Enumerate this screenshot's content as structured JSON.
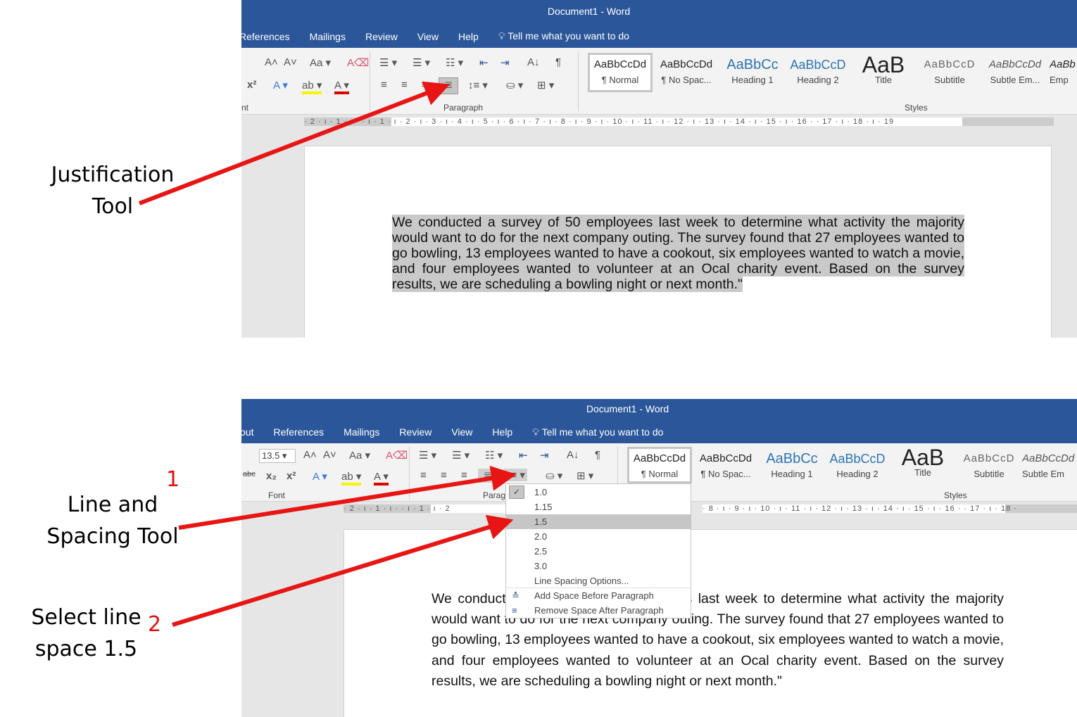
{
  "annotations": {
    "justification": [
      "Justification",
      "Tool"
    ],
    "line_spacing": [
      "Line and",
      "Spacing Tool"
    ],
    "select": [
      "Select line",
      "space 1.5"
    ],
    "step1": "1",
    "step2": "2",
    "arrow_color": "#e81515"
  },
  "top": {
    "title": "Document1  -  Word",
    "tabs": [
      "References",
      "Mailings",
      "Review",
      "View",
      "Help"
    ],
    "tell_me": "Tell me what you want to do",
    "groups": {
      "font": "nt",
      "paragraph": "Paragraph",
      "styles": "Styles"
    },
    "styles": [
      {
        "preview": "AaBbCcDd",
        "name": "¶ Normal"
      },
      {
        "preview": "AaBbCcDd",
        "name": "¶ No Spac..."
      },
      {
        "preview": "AaBbCc",
        "name": "Heading 1"
      },
      {
        "preview": "AaBbCcD",
        "name": "Heading 2"
      },
      {
        "preview": "AaB",
        "name": "Title"
      },
      {
        "preview": "AaBbCcD",
        "name": "Subtitle"
      },
      {
        "preview": "AaBbCcDd",
        "name": "Subtle Em..."
      },
      {
        "preview": "AaBb",
        "name": "Emp"
      }
    ],
    "ruler": "· 2 · ı · 1 · ı ·   · ı · 1 · ı · 2 · ı · 3 · ı · 4 · ı · 5 · ı · 6 · ı · 7 · ı · 8 · ı · 9 · ı · 10 · ı · 11 · ı · 12 · ı · 13 · ı · 14 · ı · 15 · ı · 16 ·   · 17 · ı · 18 · ı · 19",
    "paragraph": "We conducted a survey of 50 employees last week to determine what activity the majority would want to do for the next company outing. The survey found that 27 employees wanted to go bowling, 13 employees wanted to have a cookout, six employees wanted to watch a movie, and four employees wanted to volunteer at an Ocal charity event. Based on the survey results, we are scheduling a bowling night or next month.\""
  },
  "bottom": {
    "title": "Document1  -  Word",
    "tabs": [
      "out",
      "References",
      "Mailings",
      "Review",
      "View",
      "Help"
    ],
    "tell_me": "Tell me what you want to do",
    "font_size": "13.5",
    "groups": {
      "font": "Font",
      "paragraph": "Parag",
      "styles": "Styles"
    },
    "styles": [
      {
        "preview": "AaBbCcDd",
        "name": "¶ Normal"
      },
      {
        "preview": "AaBbCcDd",
        "name": "¶ No Spac..."
      },
      {
        "preview": "AaBbCc",
        "name": "Heading 1"
      },
      {
        "preview": "AaBbCcD",
        "name": "Heading 2"
      },
      {
        "preview": "AaB",
        "name": "Title"
      },
      {
        "preview": "AaBbCcD",
        "name": "Subtitle"
      },
      {
        "preview": "AaBbCcDd",
        "name": "Subtle Em"
      }
    ],
    "ruler": "· 2 · ı · 1 · ı ·   · ı · 1 · ı · 2",
    "ruler_right": "· 8 · ı · 9 · ı · 10 · ı · 11 · ı · 12 · ı · 13 · ı · 14 · ı · 15 · ı · 16 ·   · 17 · ı · 18 ·",
    "line_spacing_menu": {
      "items": [
        "1.0",
        "1.15",
        "1.5",
        "2.0",
        "2.5",
        "3.0"
      ],
      "checked": "1.0",
      "hovered": "1.5",
      "options": "Line Spacing Options...",
      "add_before": "Add Space Before Paragraph",
      "remove_after": "Remove Space After Paragraph"
    },
    "paragraph": "We conducted a survey of 50 employees last week to determine what activity the majority would want to do for the next company outing. The survey found that 27 employees wanted to go bowling, 13 employees wanted to have a cookout, six employees wanted to watch a movie, and four employees wanted to volunteer at an Ocal charity event. Based on the survey results, we are scheduling a bowling night or next month.\""
  }
}
